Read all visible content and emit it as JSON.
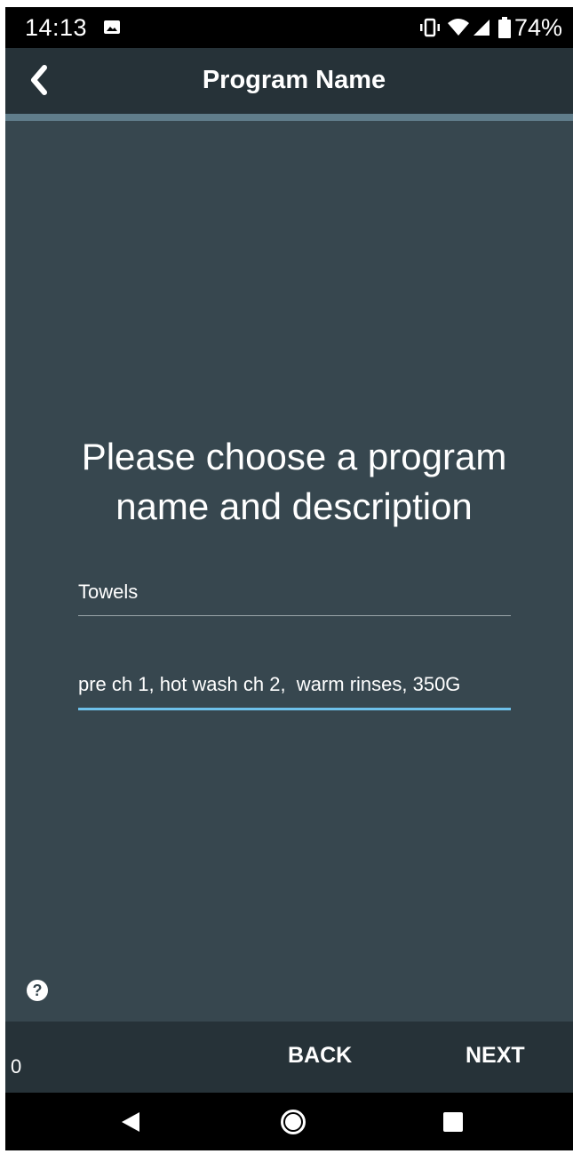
{
  "status_bar": {
    "time": "14:13",
    "battery": "74%",
    "icons": [
      "image-notification-icon",
      "vibrate-icon",
      "wifi-icon",
      "signal-icon",
      "battery-icon"
    ]
  },
  "app_bar": {
    "title": "Program Name",
    "back_icon": "chevron-left-icon"
  },
  "content": {
    "prompt": "Please choose a program name and description",
    "name_field": {
      "value": "Towels"
    },
    "description_field": {
      "value": "pre ch 1, hot wash ch 2,  warm rinses, 350G"
    },
    "help_icon": "?"
  },
  "action_bar": {
    "counter": "0",
    "back_label": "BACK",
    "next_label": "NEXT"
  },
  "nav_bar": {
    "icons": [
      "nav-back-icon",
      "nav-home-icon",
      "nav-recents-icon"
    ]
  },
  "colors": {
    "background": "#37474f",
    "bar": "#263238",
    "accent": "#607d8b",
    "focus_underline": "#6ec1ea"
  }
}
